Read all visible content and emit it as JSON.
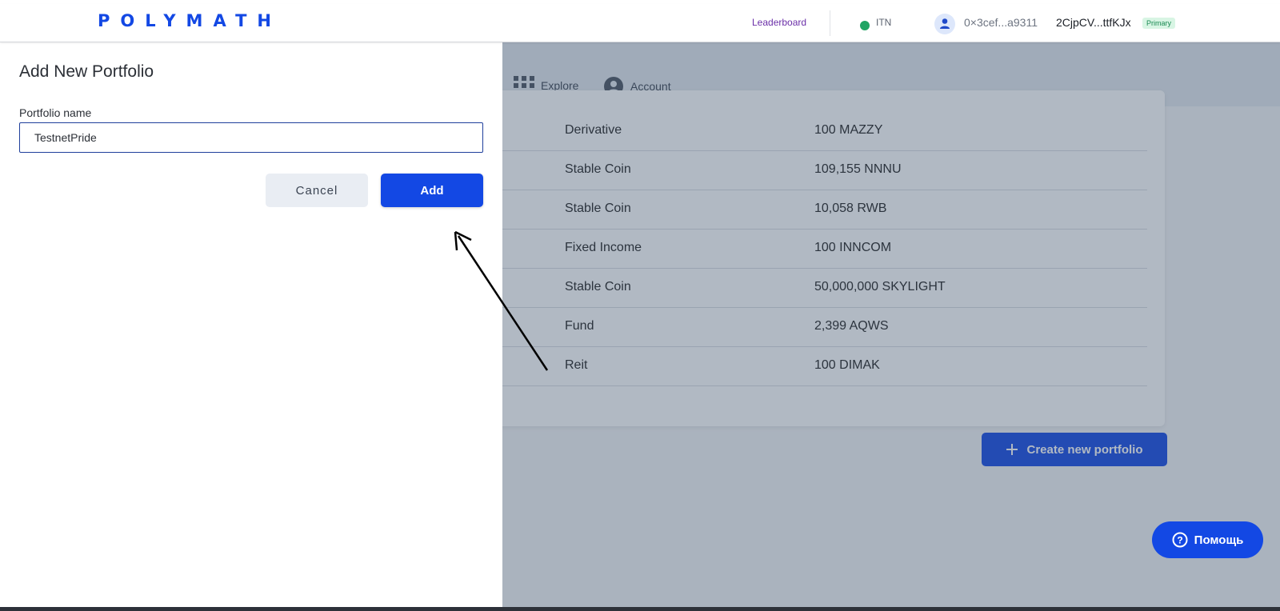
{
  "header": {
    "logo": "POLYMATH",
    "leaderboard": "Leaderboard",
    "network": "ITN",
    "network_status_color": "#1fa463",
    "account_address": "0×3cef...a9311",
    "account_key": "2CjpCV...ttfKJx",
    "account_badge": "Primary"
  },
  "subnav": {
    "items": [
      {
        "label": "Explore",
        "icon": "grid-icon"
      },
      {
        "label": "Account",
        "icon": "user-circle-icon"
      }
    ]
  },
  "table": {
    "rows": [
      {
        "type": "Derivative",
        "balance": "100 MAZZY"
      },
      {
        "type": "Stable Coin",
        "balance": "109,155 NNNU"
      },
      {
        "type": "Stable Coin",
        "balance": "10,058 RWB"
      },
      {
        "type": "Fixed Income",
        "balance": "100 INNCOM"
      },
      {
        "type": "Stable Coin",
        "balance": "50,000,000 SKYLIGHT"
      },
      {
        "type": "Fund",
        "balance": "2,399 AQWS"
      },
      {
        "type": "Reit",
        "balance": "100 DIMAK"
      }
    ]
  },
  "create_button": "Create new portfolio",
  "help_button": "Помощь",
  "dialog": {
    "title": "Add New Portfolio",
    "field_label": "Portfolio name",
    "field_value": "TestnetPride",
    "cancel": "Cancel",
    "add": "Add"
  },
  "colors": {
    "brand": "#1348e4",
    "overlay": "#3c5069"
  }
}
